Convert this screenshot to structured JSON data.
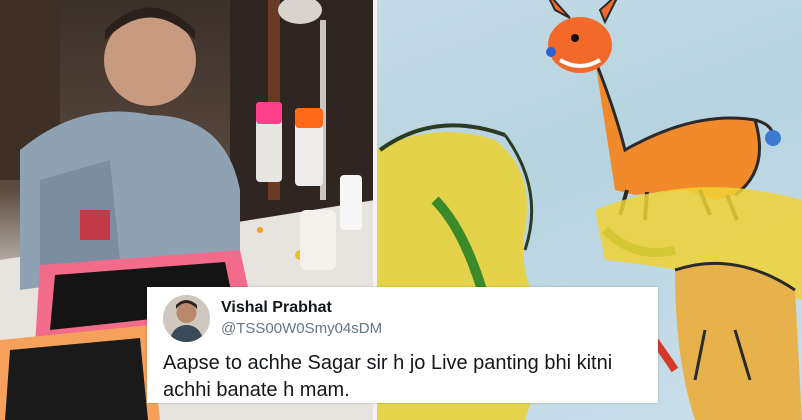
{
  "tweet": {
    "name": "Vishal Prabhat",
    "handle": "@TSS00W0Smy04sDM",
    "text": "Aapse to achhe  Sagar sir h jo Live  panting bhi kitni achhi banate h mam."
  },
  "colors": {
    "card_bg": "#ffffff",
    "name": "#14171a",
    "handle": "#657786",
    "painting_bg": "#c3dbe6"
  },
  "icons": [
    "avatar-photo"
  ]
}
